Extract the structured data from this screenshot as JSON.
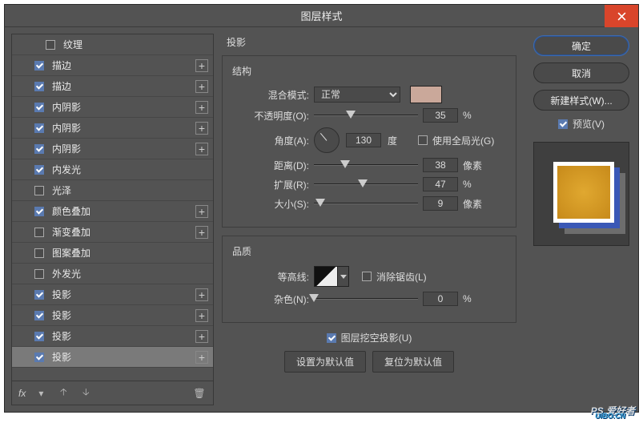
{
  "window": {
    "title": "图层样式"
  },
  "close_icon": "close",
  "sidebar": {
    "items": [
      {
        "label": "纹理",
        "checked": false,
        "add": false,
        "indent": true
      },
      {
        "label": "描边",
        "checked": true,
        "add": true
      },
      {
        "label": "描边",
        "checked": true,
        "add": true
      },
      {
        "label": "内阴影",
        "checked": true,
        "add": true
      },
      {
        "label": "内阴影",
        "checked": true,
        "add": true
      },
      {
        "label": "内阴影",
        "checked": true,
        "add": true
      },
      {
        "label": "内发光",
        "checked": true,
        "add": false
      },
      {
        "label": "光泽",
        "checked": false,
        "add": false
      },
      {
        "label": "颜色叠加",
        "checked": true,
        "add": true
      },
      {
        "label": "渐变叠加",
        "checked": false,
        "add": true
      },
      {
        "label": "图案叠加",
        "checked": false,
        "add": false
      },
      {
        "label": "外发光",
        "checked": false,
        "add": false
      },
      {
        "label": "投影",
        "checked": true,
        "add": true
      },
      {
        "label": "投影",
        "checked": true,
        "add": true
      },
      {
        "label": "投影",
        "checked": true,
        "add": true
      },
      {
        "label": "投影",
        "checked": true,
        "add": true,
        "selected": true
      }
    ],
    "footer": {
      "fx": "fx"
    }
  },
  "panel": {
    "title": "投影",
    "struct": {
      "title": "结构",
      "blend_label": "混合模式:",
      "blend_value": "正常",
      "swatch_color": "#caa89a",
      "opacity_label": "不透明度(O):",
      "opacity_value": "35",
      "opacity_unit": "%",
      "angle_label": "角度(A):",
      "angle_value": "130",
      "angle_unit": "度",
      "global_label": "使用全局光(G)",
      "global_checked": false,
      "distance_label": "距离(D):",
      "distance_value": "38",
      "distance_unit": "像素",
      "spread_label": "扩展(R):",
      "spread_value": "47",
      "spread_unit": "%",
      "size_label": "大小(S):",
      "size_value": "9",
      "size_unit": "像素"
    },
    "quality": {
      "title": "品质",
      "contour_label": "等高线:",
      "antialias_label": "消除锯齿(L)",
      "antialias_checked": false,
      "noise_label": "杂色(N):",
      "noise_value": "0",
      "noise_unit": "%"
    },
    "knockout_label": "图层挖空投影(U)",
    "knockout_checked": true,
    "default_btn": "设置为默认值",
    "reset_btn": "复位为默认值"
  },
  "right": {
    "ok": "确定",
    "cancel": "取消",
    "newstyle": "新建样式(W)...",
    "preview_label": "预览(V)",
    "preview_checked": true
  },
  "watermark": {
    "brand": "PS 爱好者",
    "url": "UiBO.CN"
  }
}
